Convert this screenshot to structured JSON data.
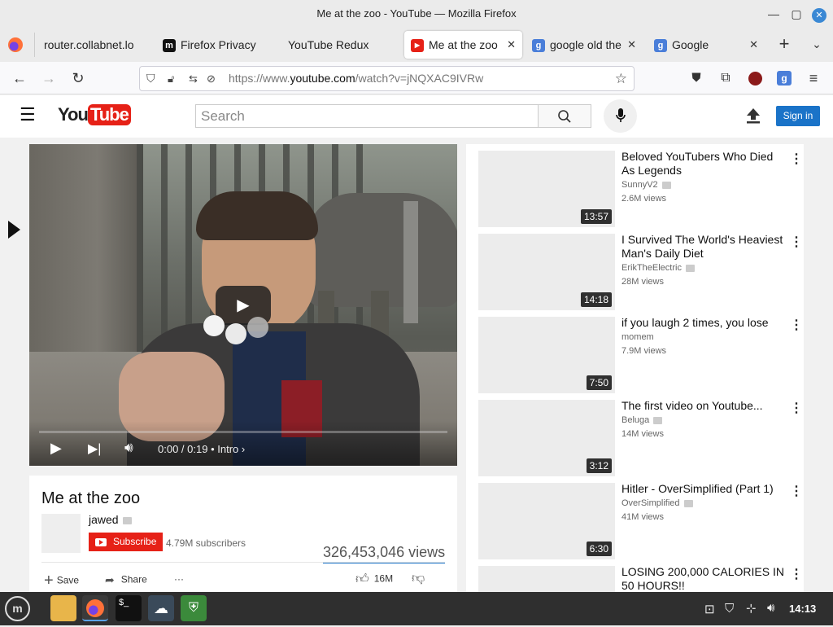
{
  "window": {
    "title": "Me at the zoo - YouTube — Mozilla Firefox"
  },
  "tabs": [
    {
      "label": "router.collabnet.lo"
    },
    {
      "label": "Firefox Privacy"
    },
    {
      "label": "YouTube Redux"
    },
    {
      "label": "Me at the zoo"
    },
    {
      "label": "google old the"
    },
    {
      "label": "Google"
    }
  ],
  "urlbar": {
    "prefix": "https://www.",
    "domain": "youtube.com",
    "path": "/watch?v=jNQXAC9IVRw"
  },
  "youtube": {
    "logo_you": "You",
    "logo_tube": "Tube",
    "search_placeholder": "Search",
    "signin_label": "Sign in"
  },
  "player": {
    "time": "0:00 / 0:19",
    "chapter": "Intro",
    "chapter_sep": "•"
  },
  "video": {
    "title": "Me at the zoo",
    "channel": "jawed",
    "subscribe_label": "Subscribe",
    "subscribers": "4.79M subscribers",
    "views": "326,453,046 views",
    "save_label": "Save",
    "share_label": "Share",
    "more_label": "···",
    "likes": "16M"
  },
  "recommendations": [
    {
      "title": "Beloved YouTubers Who Died As Legends",
      "channel": "SunnyV2",
      "views": "2.6M views",
      "duration": "13:57"
    },
    {
      "title": "I Survived The World's Heaviest Man's Daily Diet",
      "channel": "ErikTheElectric",
      "views": "28M views",
      "duration": "14:18"
    },
    {
      "title": "if you laugh 2 times, you lose",
      "channel": "momem",
      "views": "7.9M views",
      "duration": "7:50"
    },
    {
      "title": "The first video on Youtube...",
      "channel": "Beluga",
      "views": "14M views",
      "duration": "3:12"
    },
    {
      "title": "Hitler - OverSimplified (Part 1)",
      "channel": "OverSimplified",
      "views": "41M views",
      "duration": "6:30"
    },
    {
      "title": "LOSING 200,000 CALORIES IN 50 HOURS!!",
      "channel": "",
      "views": "",
      "duration": ""
    }
  ],
  "taskbar": {
    "clock": "14:13"
  },
  "colors": {
    "youtube_red": "#e62117",
    "signin_blue": "#1a73c8",
    "views_underline": "#1a73c8"
  }
}
